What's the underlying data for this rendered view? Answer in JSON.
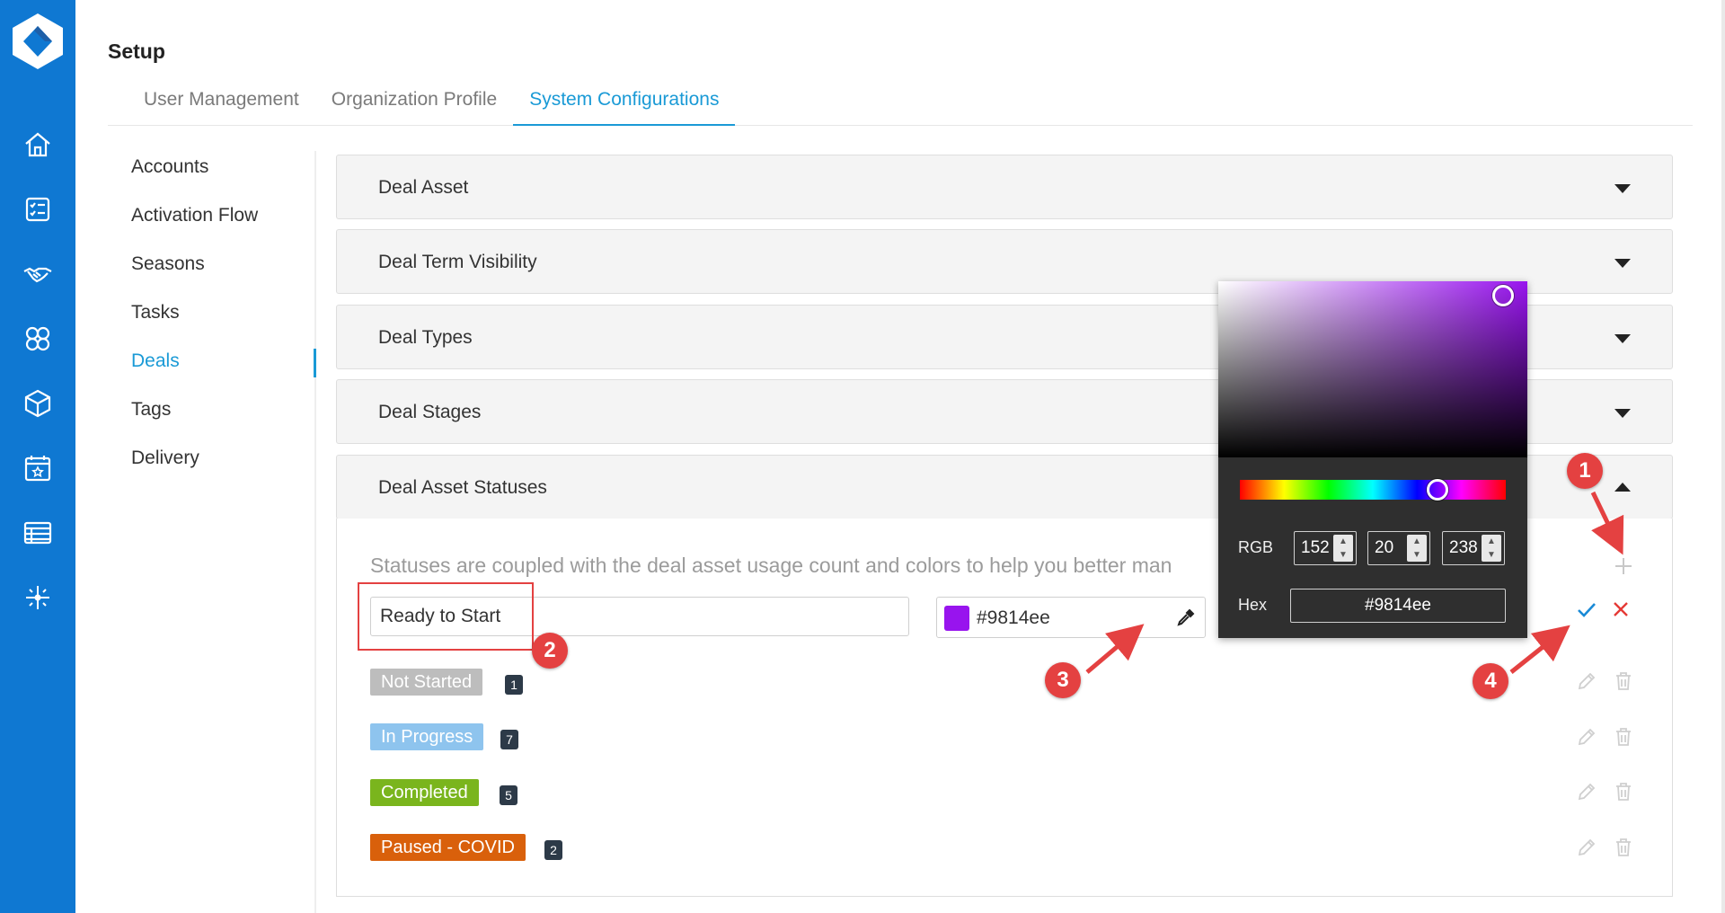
{
  "header": {
    "title": "Setup",
    "tabs": [
      {
        "label": "User Management"
      },
      {
        "label": "Organization Profile"
      },
      {
        "label": "System Configurations"
      }
    ]
  },
  "rail_icons": [
    "home-icon",
    "checklist-icon",
    "handshake-icon",
    "clover-icon",
    "cube-icon",
    "calendar-star-icon",
    "table-icon",
    "sparkle-icon"
  ],
  "subnav": {
    "items": [
      {
        "label": "Accounts"
      },
      {
        "label": "Activation Flow"
      },
      {
        "label": "Seasons"
      },
      {
        "label": "Tasks"
      },
      {
        "label": "Deals"
      },
      {
        "label": "Tags"
      },
      {
        "label": "Delivery"
      }
    ],
    "active": "Deals"
  },
  "panels": [
    {
      "title": "Deal Asset"
    },
    {
      "title": "Deal Term Visibility"
    },
    {
      "title": "Deal Types"
    },
    {
      "title": "Deal Stages"
    },
    {
      "title": "Deal Asset Statuses"
    }
  ],
  "statuses_section": {
    "description": "Statuses are coupled with the deal asset usage count and colors to help you better man",
    "new_status": {
      "name_value": "Ready to Start",
      "color_hex": "#9814ee",
      "color": "#9814ee"
    },
    "statuses": [
      {
        "label": "Not Started",
        "count": "1",
        "color": "#bdbdbd"
      },
      {
        "label": "In Progress",
        "count": "7",
        "color": "#8ec4ee"
      },
      {
        "label": "Completed",
        "count": "5",
        "color": "#7ab51d"
      },
      {
        "label": "Paused - COVID",
        "count": "2",
        "color": "#d9600b"
      }
    ]
  },
  "color_picker": {
    "rgb_label": "RGB",
    "r": "152",
    "g": "20",
    "b": "238",
    "hex_label": "Hex",
    "hex": "#9814ee",
    "hue_fraction": 0.77
  },
  "annotations": [
    "1",
    "2",
    "3",
    "4"
  ],
  "colors": {
    "rail": "#0f78d2",
    "accent": "#1a9ad6",
    "annotation_red": "#e44141",
    "confirm_blue": "#1a8ad6",
    "cancel_red": "#e53935"
  }
}
